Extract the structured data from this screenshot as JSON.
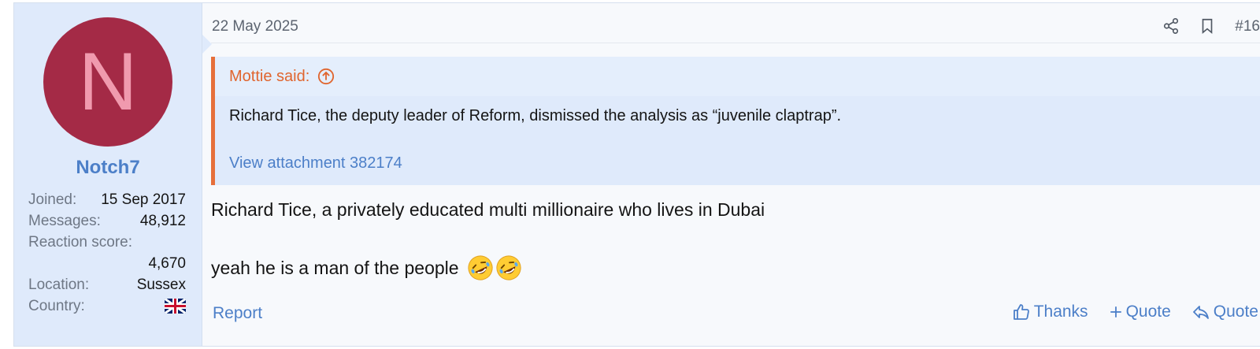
{
  "user": {
    "avatar_letter": "N",
    "username": "Notch7",
    "stats": [
      {
        "label": "Joined:",
        "value": "15 Sep 2017"
      },
      {
        "label": "Messages:",
        "value": "48,912"
      },
      {
        "label": "Reaction score:",
        "value": "4,670"
      },
      {
        "label": "Location:",
        "value": "Sussex"
      },
      {
        "label": "Country:",
        "value": "gb-flag-icon"
      }
    ]
  },
  "post": {
    "date": "22 May 2025",
    "number": "#16",
    "quote": {
      "author_line": "Mottie said:",
      "text": "Richard Tice, the deputy leader of Reform, dismissed the analysis as “juvenile claptrap”.",
      "attachment_link": "View attachment 382174"
    },
    "body_line1": "Richard Tice, a privately educated multi millionaire who lives in Dubai",
    "body_line2": "yeah he is a man of the people",
    "emojis": [
      "rolling-on-floor-laughing-emoji",
      "rolling-on-floor-laughing-emoji"
    ]
  },
  "footer": {
    "report": "Report",
    "thanks": "Thanks",
    "plus_quote": "Quote",
    "reply_quote": "Quote"
  },
  "colors": {
    "accent": "#4c7fc8",
    "quote_border": "#e66f3b",
    "avatar_bg": "#a42a46",
    "avatar_letter": "#f09aae",
    "sidebar_bg": "#dfeafb"
  }
}
